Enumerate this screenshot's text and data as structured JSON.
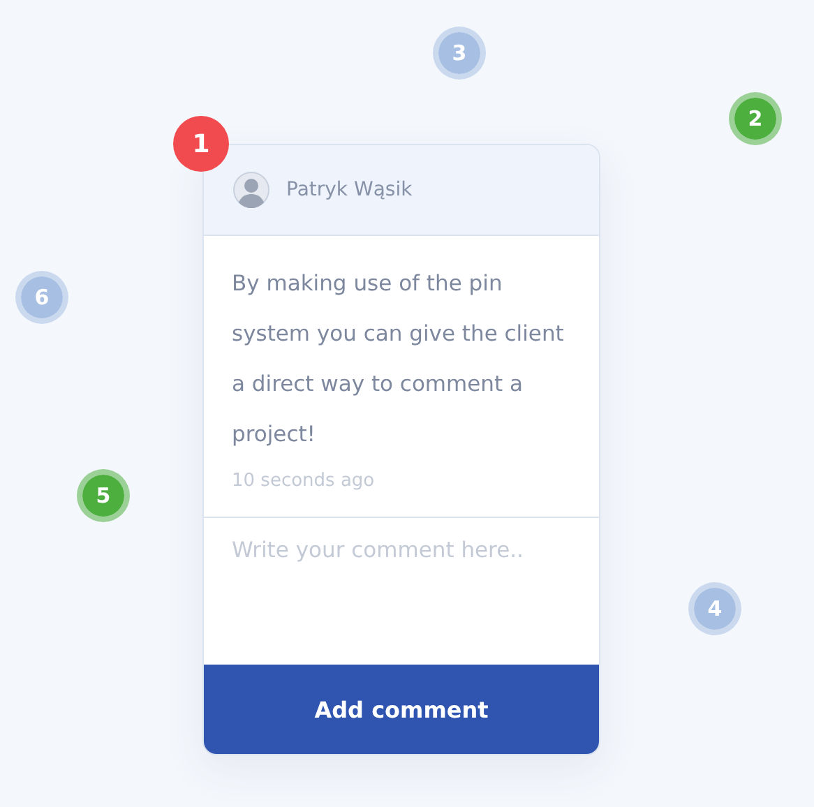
{
  "pins": [
    {
      "label": "1",
      "color": "#f24b4f"
    },
    {
      "label": "2",
      "color": "#4caf3e"
    },
    {
      "label": "3",
      "color": "#a7bfe3"
    },
    {
      "label": "4",
      "color": "#a7bfe3"
    },
    {
      "label": "5",
      "color": "#4caf3e"
    },
    {
      "label": "6",
      "color": "#a7bfe3"
    }
  ],
  "comment": {
    "author": "Patryk Wąsik",
    "text": "By making use of the pin system you can give the client a direct way to comment a project!",
    "time": "10 seconds ago"
  },
  "reply": {
    "placeholder": "Write your comment here.."
  },
  "submit": "Add comment"
}
